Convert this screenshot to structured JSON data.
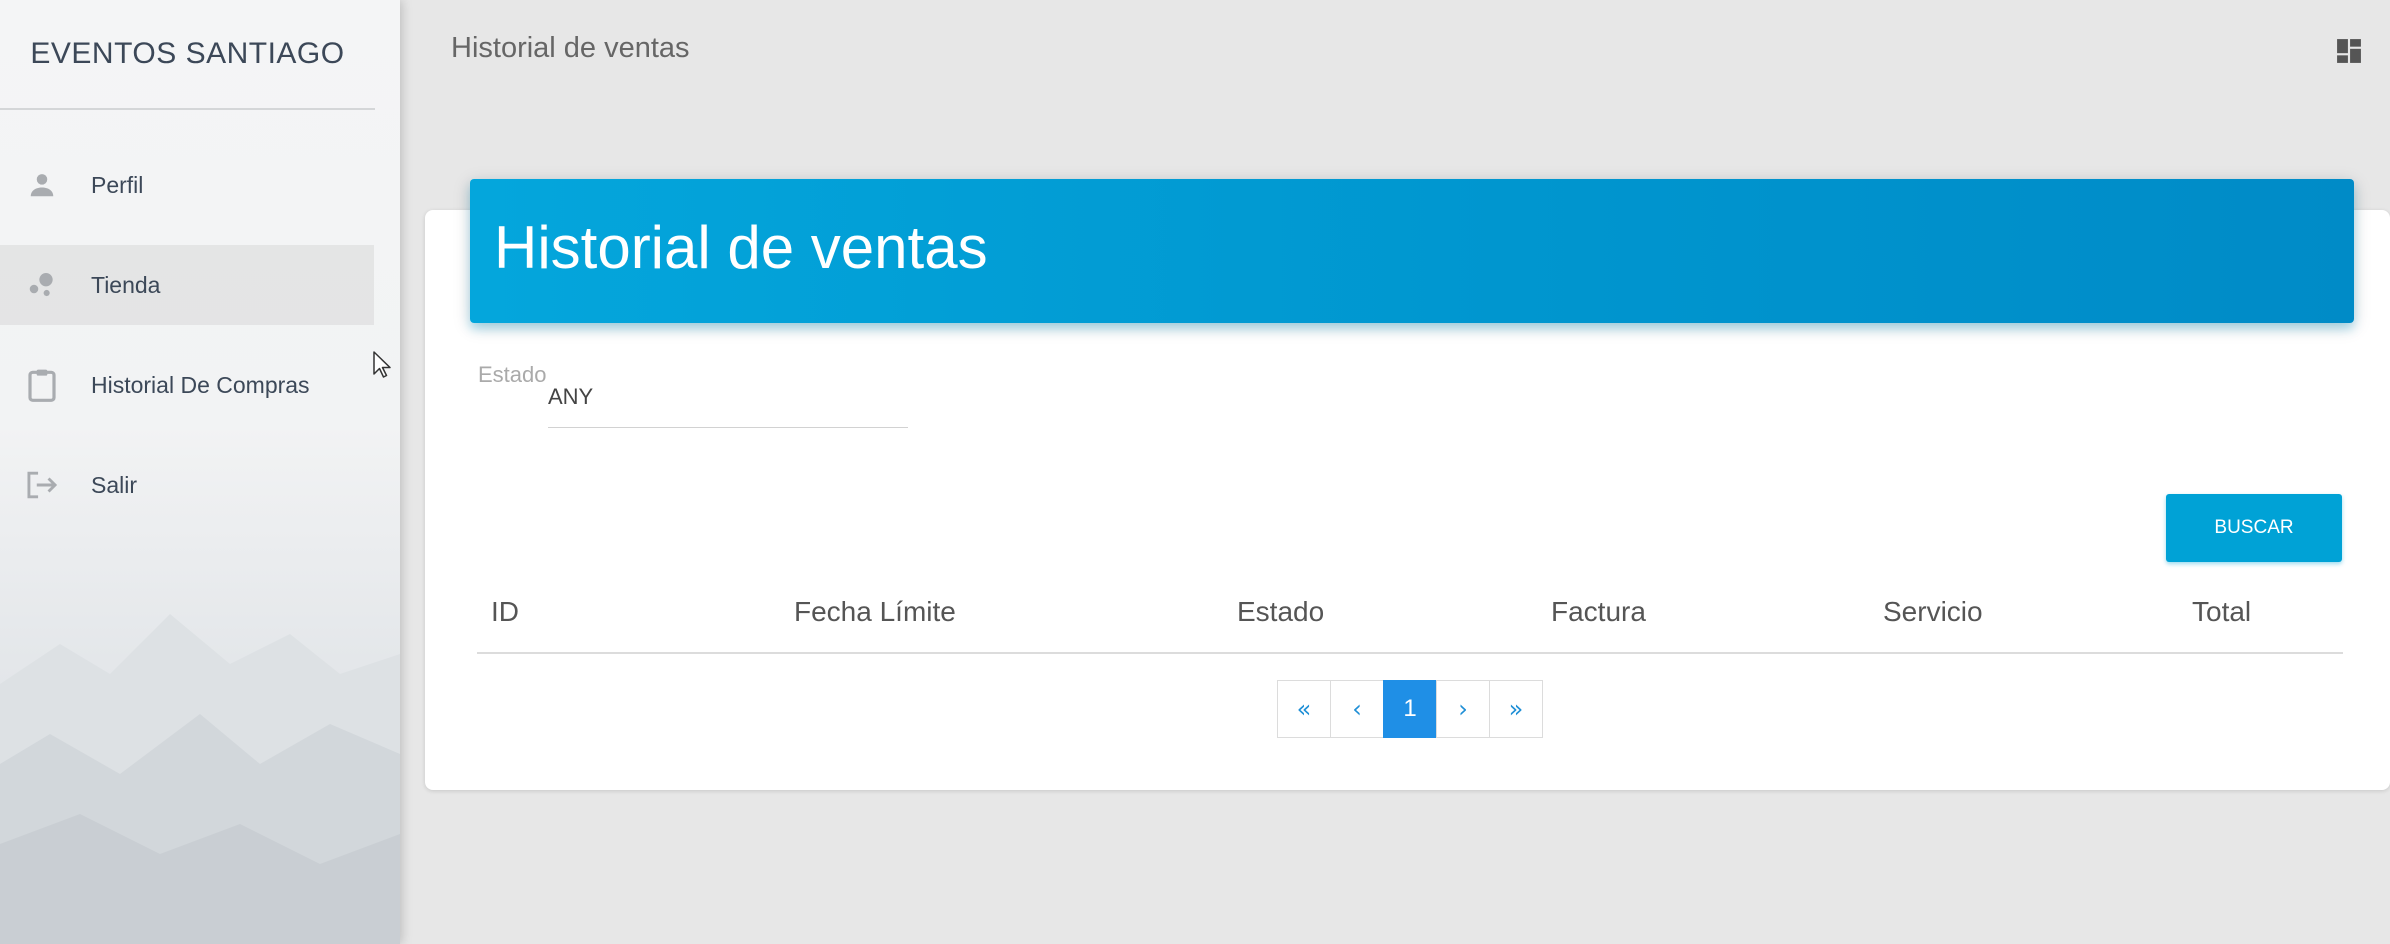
{
  "sidebar": {
    "brand": "EVENTOS SANTIAGO",
    "items": [
      {
        "label": "Perfil",
        "icon": "person-icon"
      },
      {
        "label": "Tienda",
        "icon": "bubbles-icon",
        "active": true
      },
      {
        "label": "Historial De Compras",
        "icon": "clipboard-icon"
      },
      {
        "label": "Salir",
        "icon": "logout-icon"
      }
    ]
  },
  "topbar": {
    "title": "Historial de ventas",
    "dashboard_icon": "dashboard-icon"
  },
  "card": {
    "title": "Historial de ventas",
    "header_color": "#009ad4",
    "filter": {
      "label": "Estado",
      "value": "ANY"
    },
    "search_label": "BUSCAR",
    "table": {
      "columns": [
        "ID",
        "Fecha Límite",
        "Estado",
        "Factura",
        "Servicio",
        "Total"
      ],
      "rows": []
    },
    "pagination": {
      "first": "«",
      "prev": "‹",
      "current": "1",
      "next": "›",
      "last": "»"
    }
  }
}
